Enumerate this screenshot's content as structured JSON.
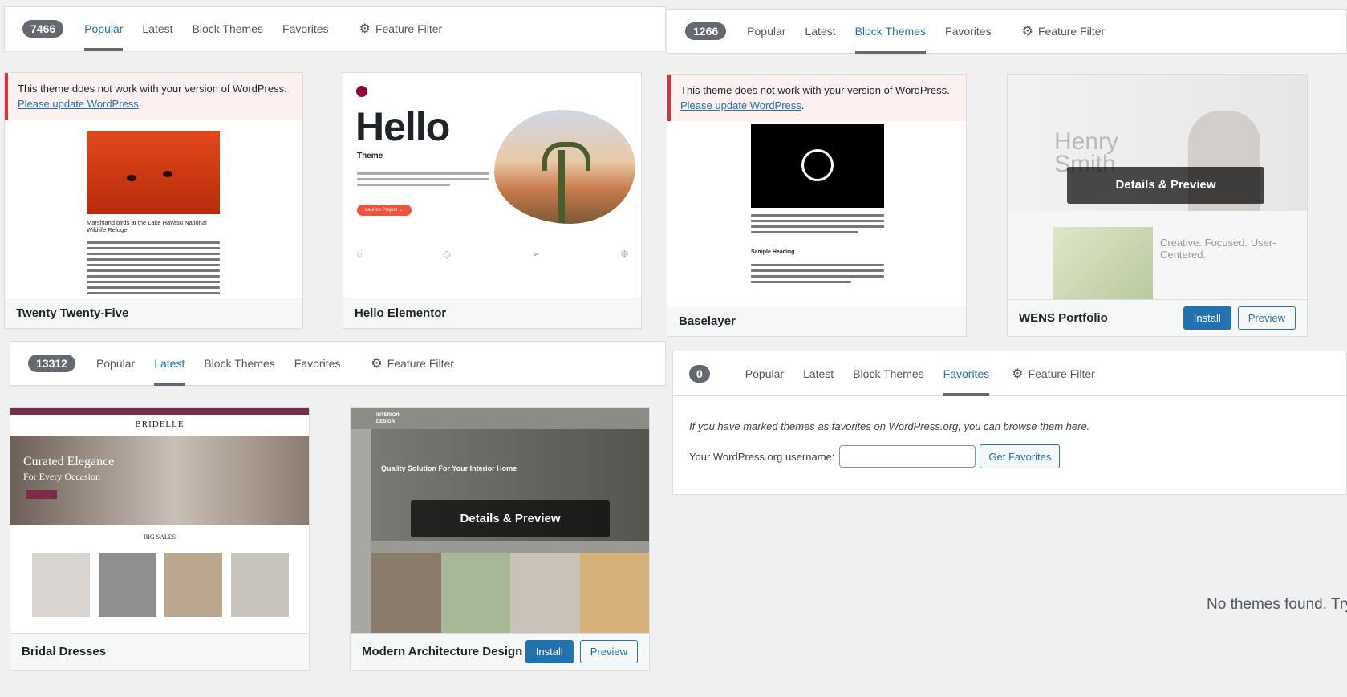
{
  "panels": {
    "popular": {
      "count": "7466",
      "tabs": [
        "Popular",
        "Latest",
        "Block Themes",
        "Favorites"
      ],
      "feature_filter": "Feature Filter",
      "active": "Popular",
      "themes": [
        {
          "name": "Twenty Twenty-Five",
          "notice": "This theme does not work with your version of WordPress.",
          "notice_link": "Please update WordPress",
          "shot_caption": "Marshland birds at the Lake Havasu National Wildlife Refuge"
        },
        {
          "name": "Hello Elementor",
          "shot_title": "Hello",
          "shot_sub": "Theme",
          "shot_button": "Launch Project →"
        }
      ]
    },
    "block": {
      "count": "1266",
      "tabs": [
        "Popular",
        "Latest",
        "Block Themes",
        "Favorites"
      ],
      "feature_filter": "Feature Filter",
      "active": "Block Themes",
      "themes": [
        {
          "name": "Baselayer",
          "notice": "This theme does not work with your version of WordPress.",
          "notice_link": "Please update WordPress",
          "shot_heading": "Sample Heading"
        },
        {
          "name": "WENS Portfolio",
          "install": "Install",
          "preview": "Preview",
          "overlay": "Details & Preview",
          "shot_name": "Henry Smith",
          "shot_tag": "Creative. Focused. User-Centered."
        }
      ]
    },
    "latest": {
      "count": "13312",
      "tabs": [
        "Popular",
        "Latest",
        "Block Themes",
        "Favorites"
      ],
      "feature_filter": "Feature Filter",
      "active": "Latest",
      "themes": [
        {
          "name": "Bridal Dresses",
          "shot_brand": "BRIDELLE",
          "shot_hero1": "Curated Elegance",
          "shot_hero2": "For Every Occasion",
          "shot_sales": "BIG SALES"
        },
        {
          "name": "Modern Architecture Design",
          "install": "Install",
          "preview": "Preview",
          "overlay": "Details & Preview",
          "shot_hero": "Quality Solution For Your Interior Home",
          "shot_brand": "INTERIOR DESIGN"
        }
      ]
    },
    "favorites": {
      "count": "0",
      "tabs": [
        "Popular",
        "Latest",
        "Block Themes",
        "Favorites"
      ],
      "feature_filter": "Feature Filter",
      "active": "Favorites",
      "intro": "If you have marked themes as favorites on WordPress.org, you can browse them here.",
      "username_label": "Your WordPress.org username:",
      "username_value": "",
      "get_button": "Get Favorites"
    }
  },
  "no_themes": "No themes found. Try",
  "colors": {
    "accent": "#2271b1",
    "count_badge": "#646970",
    "notice_border": "#d63638",
    "notice_bg": "#fcf0f1"
  }
}
